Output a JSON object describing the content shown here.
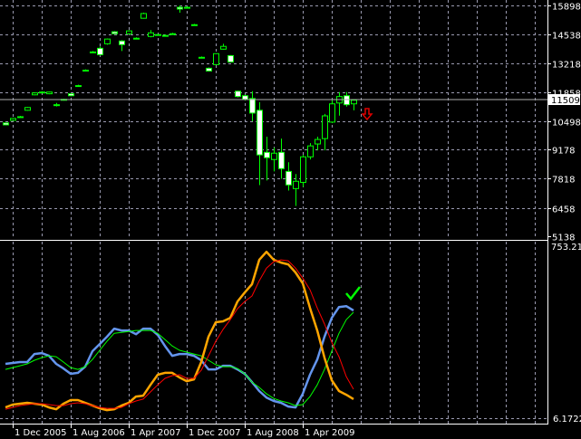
{
  "chart_data": [
    {
      "type": "candlestick",
      "title": "",
      "price_axis_ticks": [
        "15898",
        "14538",
        "13218",
        "11858",
        "10498",
        "9178",
        "7818",
        "6458",
        "5138"
      ],
      "ylim": [
        5138,
        15898
      ],
      "current_price": "11509",
      "candle_format": [
        "open",
        "high",
        "low",
        "close"
      ],
      "candles": [
        [
          10420,
          10440,
          10310,
          10330
        ],
        [
          10540,
          10650,
          10520,
          10630
        ],
        [
          10710,
          10750,
          10670,
          10710
        ],
        [
          11010,
          11160,
          10990,
          11140
        ],
        [
          11730,
          11840,
          11710,
          11820
        ],
        [
          11860,
          11900,
          11820,
          11860
        ],
        [
          11780,
          11880,
          11760,
          11860
        ],
        [
          11270,
          11350,
          11190,
          11270
        ],
        [
          11520,
          11540,
          11460,
          11480
        ],
        [
          11780,
          11800,
          11670,
          11690
        ],
        [
          12160,
          12200,
          12120,
          12160
        ],
        [
          12880,
          12920,
          12840,
          12880
        ],
        [
          13730,
          13770,
          13690,
          13730
        ],
        [
          13900,
          13990,
          13560,
          13600
        ],
        [
          14110,
          14360,
          14070,
          14330
        ],
        [
          14670,
          14700,
          14570,
          14580
        ],
        [
          14240,
          14280,
          13770,
          14070
        ],
        [
          14580,
          14740,
          14560,
          14710
        ],
        [
          14370,
          14410,
          14330,
          14370
        ],
        [
          15300,
          15560,
          15280,
          15520
        ],
        [
          14450,
          14750,
          14410,
          14620
        ],
        [
          14540,
          14560,
          14520,
          14540
        ],
        [
          14500,
          14540,
          14460,
          14490
        ],
        [
          14580,
          14620,
          14540,
          14580
        ],
        [
          15810,
          15900,
          15560,
          15730
        ],
        [
          15810,
          15850,
          15770,
          15810
        ],
        [
          15000,
          15040,
          14960,
          15000
        ],
        [
          13480,
          13520,
          13440,
          13480
        ],
        [
          12970,
          13010,
          12820,
          12840
        ],
        [
          13140,
          13650,
          13120,
          13650
        ],
        [
          13860,
          14110,
          13840,
          13990
        ],
        [
          13560,
          13580,
          13240,
          13260
        ],
        [
          11900,
          11920,
          11610,
          11650
        ],
        [
          11690,
          11730,
          11460,
          11520
        ],
        [
          11560,
          11900,
          10500,
          10880
        ],
        [
          11010,
          11390,
          7520,
          8930
        ],
        [
          9050,
          9780,
          7740,
          8800
        ],
        [
          8715,
          9270,
          8160,
          9010
        ],
        [
          9050,
          9690,
          7820,
          8290
        ],
        [
          8160,
          8590,
          7270,
          7530
        ],
        [
          7360,
          8040,
          6550,
          7700
        ],
        [
          7650,
          8930,
          7440,
          8840
        ],
        [
          8840,
          9480,
          8720,
          9350
        ],
        [
          9440,
          9780,
          9140,
          9650
        ],
        [
          9690,
          10840,
          9140,
          10750
        ],
        [
          10460,
          11480,
          10410,
          11310
        ],
        [
          11350,
          11860,
          10760,
          11650
        ],
        [
          11690,
          11860,
          11180,
          11270
        ],
        [
          11310,
          11520,
          11010,
          11480
        ]
      ],
      "signal_arrow": {
        "type": "sell-arrow",
        "color": "#e00000"
      }
    },
    {
      "type": "line",
      "indicator_axis_max": "753.217",
      "indicator_axis_min": "6.1722",
      "ylim": [
        6.1722,
        753.217
      ],
      "x_labels": [
        "1 Dec 2005",
        "1 Aug 2006",
        "1 Apr 2007",
        "1 Dec 2007",
        "1 Aug 2008",
        "1 Apr 2009"
      ],
      "series": [
        {
          "name": "blue",
          "color": "#6495ed",
          "width": 2.5,
          "values": [
            242,
            246,
            250,
            250,
            285,
            289,
            277,
            242,
            222,
            199,
            203,
            230,
            297,
            328,
            360,
            395,
            387,
            387,
            371,
            395,
            395,
            368,
            320,
            277,
            285,
            285,
            277,
            258,
            218,
            218,
            234,
            234,
            218,
            199,
            163,
            124,
            96,
            81,
            73,
            57,
            53,
            112,
            195,
            261,
            360,
            442,
            489,
            493,
            474
          ]
        },
        {
          "name": "green",
          "color": "#00ff00",
          "width": 1,
          "values": [
            218,
            226,
            234,
            242,
            258,
            269,
            277,
            273,
            250,
            226,
            218,
            230,
            261,
            301,
            340,
            375,
            379,
            383,
            387,
            387,
            387,
            375,
            348,
            320,
            301,
            293,
            285,
            277,
            258,
            238,
            230,
            230,
            222,
            199,
            163,
            140,
            112,
            92,
            81,
            73,
            61,
            65,
            100,
            151,
            218,
            297,
            375,
            434,
            466
          ]
        },
        {
          "name": "orange",
          "color": "#ffa500",
          "width": 2.5,
          "values": [
            53,
            65,
            69,
            73,
            69,
            65,
            53,
            45,
            69,
            85,
            85,
            73,
            61,
            49,
            41,
            45,
            61,
            73,
            100,
            104,
            151,
            195,
            203,
            203,
            183,
            167,
            175,
            250,
            360,
            423,
            427,
            442,
            513,
            552,
            588,
            694,
            729,
            694,
            682,
            674,
            639,
            592,
            485,
            387,
            269,
            171,
            124,
            108,
            89
          ]
        },
        {
          "name": "red",
          "color": "#ff0000",
          "width": 1,
          "values": [
            45,
            53,
            61,
            65,
            69,
            69,
            65,
            61,
            61,
            69,
            73,
            69,
            61,
            53,
            49,
            49,
            53,
            69,
            81,
            89,
            120,
            151,
            179,
            191,
            195,
            179,
            179,
            214,
            277,
            340,
            391,
            434,
            482,
            513,
            537,
            603,
            658,
            686,
            694,
            690,
            658,
            615,
            564,
            485,
            415,
            336,
            273,
            187,
            132
          ]
        }
      ],
      "signal_mark": {
        "type": "check-mark",
        "color": "#00ff00"
      }
    }
  ]
}
